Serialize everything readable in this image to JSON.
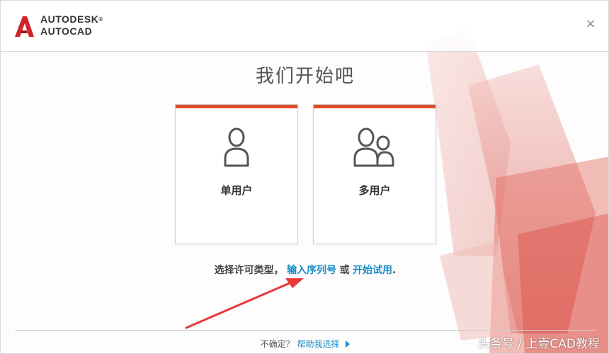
{
  "brand": {
    "line1": "AUTODESK",
    "line2": "AUTOCAD",
    "mark": "®"
  },
  "header": {
    "close": "×"
  },
  "title": "我们开始吧",
  "cards": [
    {
      "label": "单用户",
      "icon": "single-user-icon"
    },
    {
      "label": "多用户",
      "icon": "multi-user-icon"
    }
  ],
  "prompt": {
    "text": "选择许可类型，",
    "serial_link": "输入序列号",
    "or": "或",
    "trial_link": "开始试用",
    "end": "."
  },
  "footer": {
    "question": "不确定？",
    "help_link": "帮助我选择"
  },
  "watermark": "头条号 / 上壹CAD教程",
  "colors": {
    "accent": "#e04b2b",
    "link": "#1a8cc7",
    "arrow": "#e8393a"
  }
}
